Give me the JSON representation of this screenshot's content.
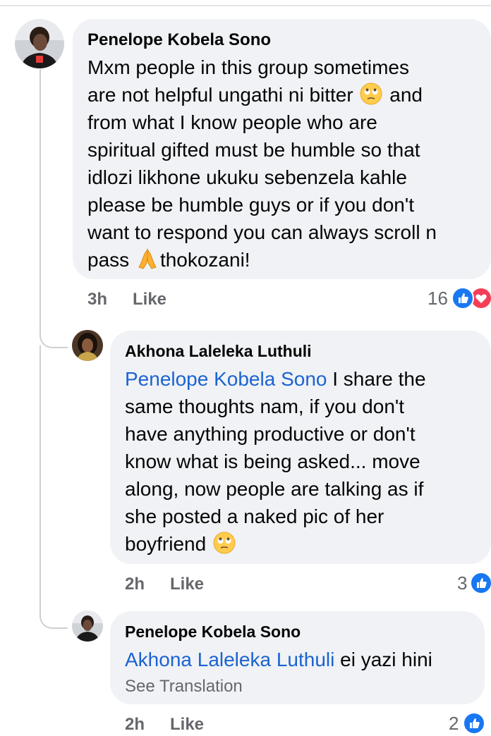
{
  "comments": [
    {
      "author": "Penelope Kobela Sono",
      "lines": [
        {
          "before": "Mxm people in this group sometimes"
        },
        {
          "before": "are not helpful ungathi ni bitter",
          "emoji": "face-with-rolling-eyes-emoji",
          "after": "and"
        },
        {
          "before": "from what I know people who are"
        },
        {
          "before": "spiritual gifted must be humble so that"
        },
        {
          "before": "idlozi likhone ukuku sebenzela kahle"
        },
        {
          "before": "please be humble guys or if you don't"
        },
        {
          "before": "want to respond you can always scroll n"
        },
        {
          "before": "pass",
          "emoji": "folded-hands-emoji",
          "after": "thokozani!"
        }
      ],
      "time": "3h",
      "like_label": "Like",
      "reaction_count": "16",
      "reactions": [
        "like-icon",
        "love-icon"
      ]
    },
    {
      "author": "Akhona Laleleka Luthuli",
      "mention": "Penelope Kobela Sono",
      "lines": [
        {
          "before": "I share the"
        },
        {
          "before": "same thoughts nam, if you don't"
        },
        {
          "before": "have anything productive or don't"
        },
        {
          "before": "know what is being asked... move"
        },
        {
          "before": "along, now people are talking as if"
        },
        {
          "before": "she posted a naked pic of her"
        },
        {
          "before": "boyfriend",
          "emoji": "face-with-rolling-eyes-emoji"
        }
      ],
      "time": "2h",
      "like_label": "Like",
      "reaction_count": "3",
      "reactions": [
        "like-icon"
      ]
    },
    {
      "author": "Penelope Kobela Sono",
      "mention": "Akhona Laleleka Luthuli",
      "lines": [
        {
          "before": "ei yazi hini"
        }
      ],
      "see_translation": "See Translation",
      "time": "2h",
      "like_label": "Like",
      "reaction_count": "2",
      "reactions": [
        "like-icon"
      ]
    }
  ],
  "colors": {
    "bubble": "#f0f2f5",
    "mention": "#1b63d1",
    "meta": "#65676b",
    "like": "#1877f2",
    "love": "#f33e58"
  }
}
